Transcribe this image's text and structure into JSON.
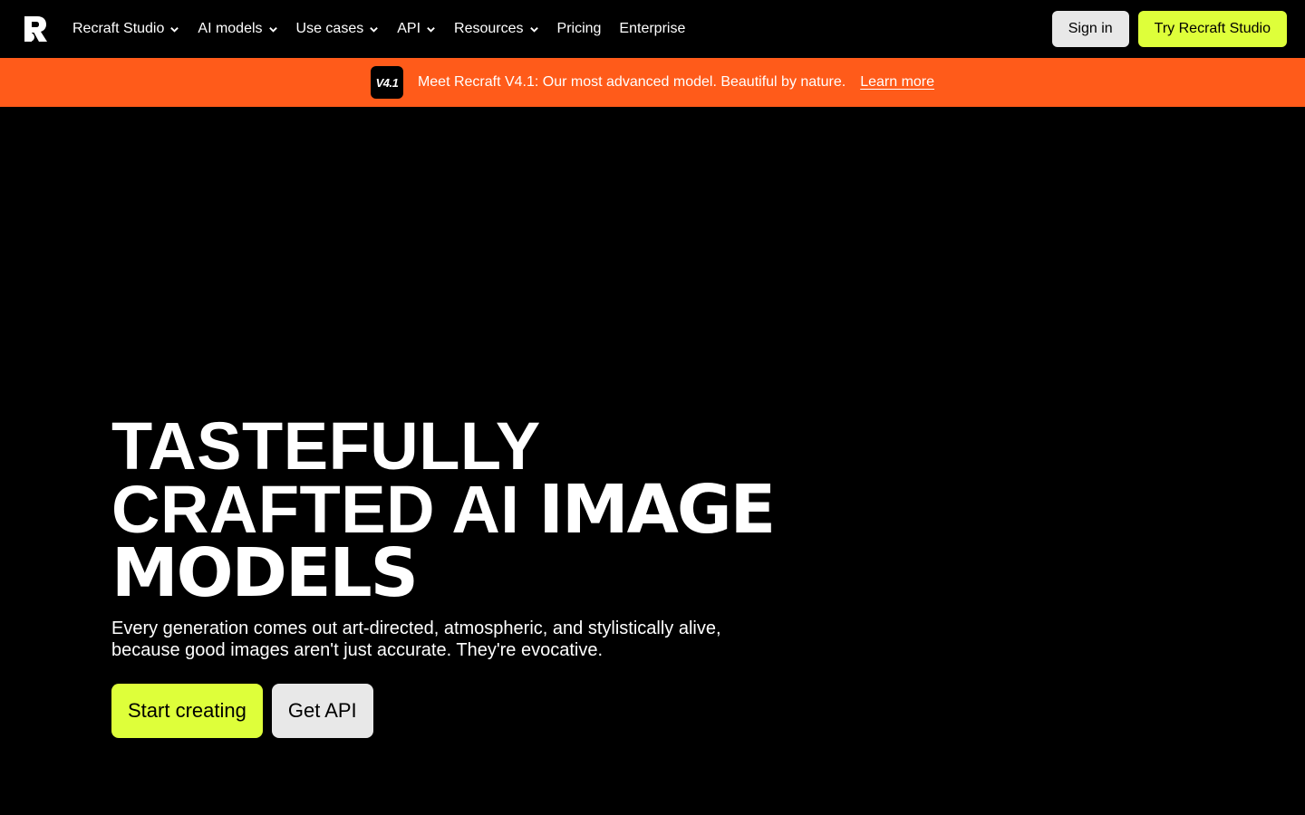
{
  "nav": {
    "logo_icon": "recraft-logo-icon",
    "items": [
      {
        "label": "Recraft Studio",
        "has_dropdown": true
      },
      {
        "label": "AI models",
        "has_dropdown": true
      },
      {
        "label": "Use cases",
        "has_dropdown": true
      },
      {
        "label": "API",
        "has_dropdown": true
      },
      {
        "label": "Resources",
        "has_dropdown": true
      },
      {
        "label": "Pricing",
        "has_dropdown": false
      },
      {
        "label": "Enterprise",
        "has_dropdown": false
      }
    ],
    "signin_label": "Sign in",
    "try_label": "Try Recraft Studio"
  },
  "banner": {
    "badge": "V4.1",
    "text": "Meet Recraft V4.1: Our most advanced model. Beautiful by nature.",
    "link": "Learn more"
  },
  "hero": {
    "title_line1": "TASTEFULLY",
    "title_line2_a": "CRAFTED AI ",
    "title_line2_b": "IMAGE",
    "title_line3": "MODELS",
    "subtitle": "Every generation comes out art-directed, atmospheric, and stylistically alive, because good images aren't just accurate. They're evocative.",
    "start_label": "Start creating",
    "api_label": "Get API"
  },
  "colors": {
    "background": "#000000",
    "accent_lime": "#deff3a",
    "banner_orange": "#ff5b1a",
    "secondary_button": "#e8e8e8"
  }
}
